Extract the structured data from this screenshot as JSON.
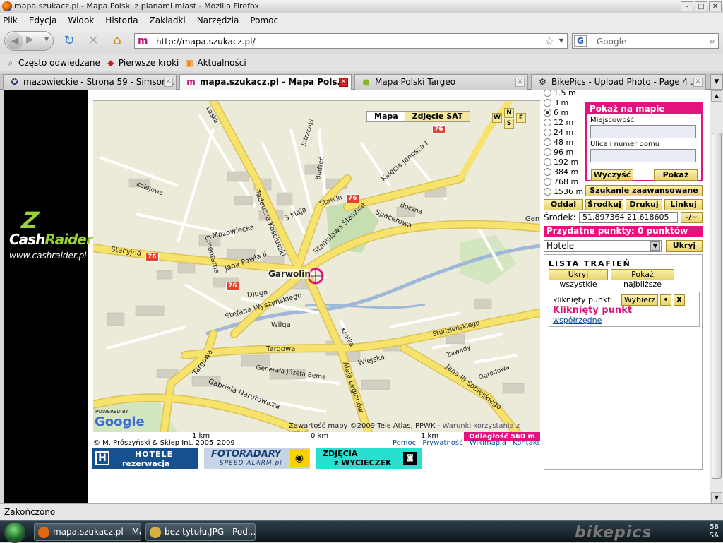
{
  "window": {
    "title": "mapa.szukacz.pl - Mapa Polski z planami miast - Mozilla Firefox"
  },
  "menu": [
    "Plik",
    "Edycja",
    "Widok",
    "Historia",
    "Zakładki",
    "Narzędzia",
    "Pomoc"
  ],
  "nav": {
    "url": "http://mapa.szukacz.pl/",
    "search_placeholder": "Google"
  },
  "bookmarks": [
    {
      "label": "Często odwiedzane",
      "icon": "search-icon"
    },
    {
      "label": "Pierwsze kroki",
      "icon": "firefox-icon"
    },
    {
      "label": "Aktualności",
      "icon": "rss-icon"
    }
  ],
  "tabs": [
    {
      "label": "mazowieckie - Strona 59 - Simson...",
      "active": false
    },
    {
      "label": "mapa.szukacz.pl - Mapa Pols...",
      "active": true
    },
    {
      "label": "Mapa Polski Targeo",
      "active": false
    },
    {
      "label": "BikePics - Upload Photo - Page 4 ...",
      "active": false
    }
  ],
  "ad": {
    "brand_main": "Cash",
    "brand_accent": "Raider",
    "url": "www.cashraider.pl"
  },
  "map": {
    "mode_map": "Mapa",
    "mode_sat": "Zdjęcie SAT",
    "dirs": {
      "n": "N",
      "w": "W",
      "s": "S",
      "e": "E"
    },
    "town": "Garwolin",
    "streets": {
      "staszica": "Stanisława Staszica",
      "kosciuszki": "Tadeusza Kościuszki",
      "majaa": "3 Maja",
      "mazowiecka": "Mazowiecka",
      "jp2": "Jana Pawła II",
      "cmentarna": "Cmentarna",
      "stacyjna": "Stacyjna",
      "dluga": "Długa",
      "wyszynskiego": "Stefana Wyszyńskiego",
      "wilga1": "Wilga",
      "targowa1": "Targowa",
      "targowa2": "Targowa",
      "narutowicza": "Gabriela Narutowicza",
      "wiejska": "Wiejska",
      "sobieskiego": "Jana III Sobieskiego",
      "legionow": "Aleja Legionów",
      "spacerowa": "Spacerowa",
      "stawki": "Stawki",
      "janusza": "Księcia Janusza I",
      "generala": "Generała Józefa Bema",
      "zawady": "Zawady",
      "ogrodowa": "Ogrodowa",
      "studzienskiego": "Studzieńskiego",
      "boczna": "Boczna",
      "budzen": "Budzeń",
      "jutrzenki": "Jutrzenki",
      "laska": "Laska",
      "kolejowa": "Kolejowa",
      "krotka": "Krótka",
      "gen": "Gen"
    },
    "road_numbers": [
      "76",
      "76",
      "76",
      "76",
      "76"
    ],
    "powered": "POWERED BY",
    "google": "Google",
    "attribution": "Zawartość mapy ©2009 Tele Atlas, PPWK -",
    "terms_link": "Warunki korzystania z usługi",
    "scale_left": "1 km",
    "scale_mid": "0 km",
    "scale_right": "1 km",
    "distance": "Odległość 560 m"
  },
  "footer": {
    "copyright": "© M. Prószyński & Sklep Int. 2005–2009",
    "links": [
      "Pomoc",
      "Prywatność",
      "Wikimapia",
      "Kontakt"
    ]
  },
  "banners": {
    "hotels_icon": "H",
    "hotels_1": "HOTELE",
    "hotels_2": "rezerwacja online",
    "foto_1": "FOTORADARY",
    "foto_2": "SPEED ALARM.pl",
    "trips_1": "ZDJĘCIA",
    "trips_2": "z WYCIECZEK"
  },
  "panel": {
    "zoom_levels": [
      "1.5 m",
      "3 m",
      "6 m",
      "12 m",
      "24 m",
      "48 m",
      "96 m",
      "192 m",
      "384 m",
      "768 m",
      "1536 m"
    ],
    "zoom_selected": "6 m",
    "show_on_map": "Pokaż na mapie",
    "city_label": "Miejscowość",
    "city_value": "",
    "street_label": "Ulica i numer domu",
    "street_value": "",
    "clear_btn": "Wyczyść",
    "show_btn": "Pokaż",
    "advanced_btn": "Szukanie zaawansowane",
    "zoom_out_btn": "Oddal",
    "center_btn": "Środkuj",
    "print_btn": "Drukuj",
    "link_btn": "Linkuj",
    "center_label": "Środek:",
    "center_value": "51.897364 21.618605",
    "format_btn": "-/~",
    "useful_points": "Przydatne punkty: 0 punktów",
    "category_value": "Hotele",
    "hide_btn": "Ukryj",
    "results_title": "LISTA TRAFIEŃ",
    "hide_all_btn": "Ukryj wszystkie",
    "show_nearest_btn": "Pokaż najbliższe",
    "clicked_small": "kliknięty punkt",
    "choose_btn": "Wybierz",
    "dot_btn": "•",
    "close_btn": "X",
    "clicked_title": "Kliknięty punkt",
    "coords_link": "współrzędne"
  },
  "status": {
    "text": "Zakończono"
  },
  "taskbar": {
    "tasks": [
      {
        "label": "mapa.szukacz.pl - Ma...",
        "icon": "firefox-icon"
      },
      {
        "label": "bez tytułu.JPG - Pod...",
        "icon": "paint-icon"
      }
    ],
    "clock": "58",
    "day": "SA",
    "watermark": "bikepics"
  },
  "colors": {
    "accent": "#e2137e",
    "road_major": "#f7e26b",
    "map_bg": "#ecead9"
  }
}
